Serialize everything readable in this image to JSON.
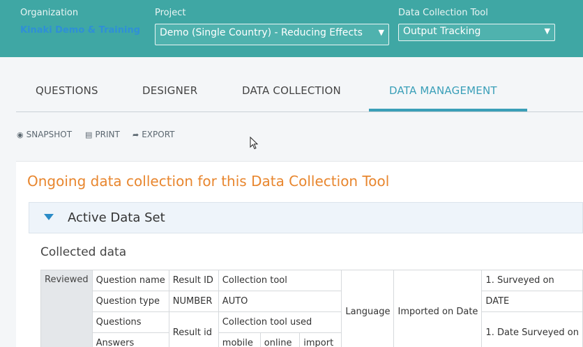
{
  "header": {
    "organization_label": "Organization",
    "organization_value": "Kinaki Demo & Training",
    "project_label": "Project",
    "project_value": "Demo (Single Country) - Reducing Effects",
    "tool_label": "Data Collection Tool",
    "tool_value": "Output Tracking"
  },
  "tabs": [
    {
      "label": "QUESTIONS",
      "active": false
    },
    {
      "label": "DESIGNER",
      "active": false
    },
    {
      "label": "DATA COLLECTION",
      "active": false
    },
    {
      "label": "DATA MANAGEMENT",
      "active": true
    }
  ],
  "toolbar": {
    "snapshot": "SNAPSHOT",
    "print": "PRINT",
    "export": "EXPORT"
  },
  "main": {
    "title": "Ongoing data collection for this Data Collection Tool",
    "accordion_title": "Active Data Set",
    "section_title": "Collected data"
  },
  "table": {
    "reviewed": "Reviewed",
    "question_name": "Question name",
    "result_id_header": "Result ID",
    "collection_tool": "Collection tool",
    "language": "Language",
    "imported_on_date": "Imported on Date",
    "surveyed_on": "1. Surveyed on",
    "question_type": "Question type",
    "number": "NUMBER",
    "auto": "AUTO",
    "date": "DATE",
    "questions": "Questions",
    "result_id": "Result id",
    "collection_tool_used": "Collection tool used",
    "date_surveyed_on": "1. Date Surveyed on",
    "answers": "Answers",
    "mobile": "mobile",
    "online": "online",
    "import": "import"
  },
  "colors": {
    "header_bg": "#3fa7a4",
    "accent": "#3a9fb8",
    "title_orange": "#e8862e"
  }
}
